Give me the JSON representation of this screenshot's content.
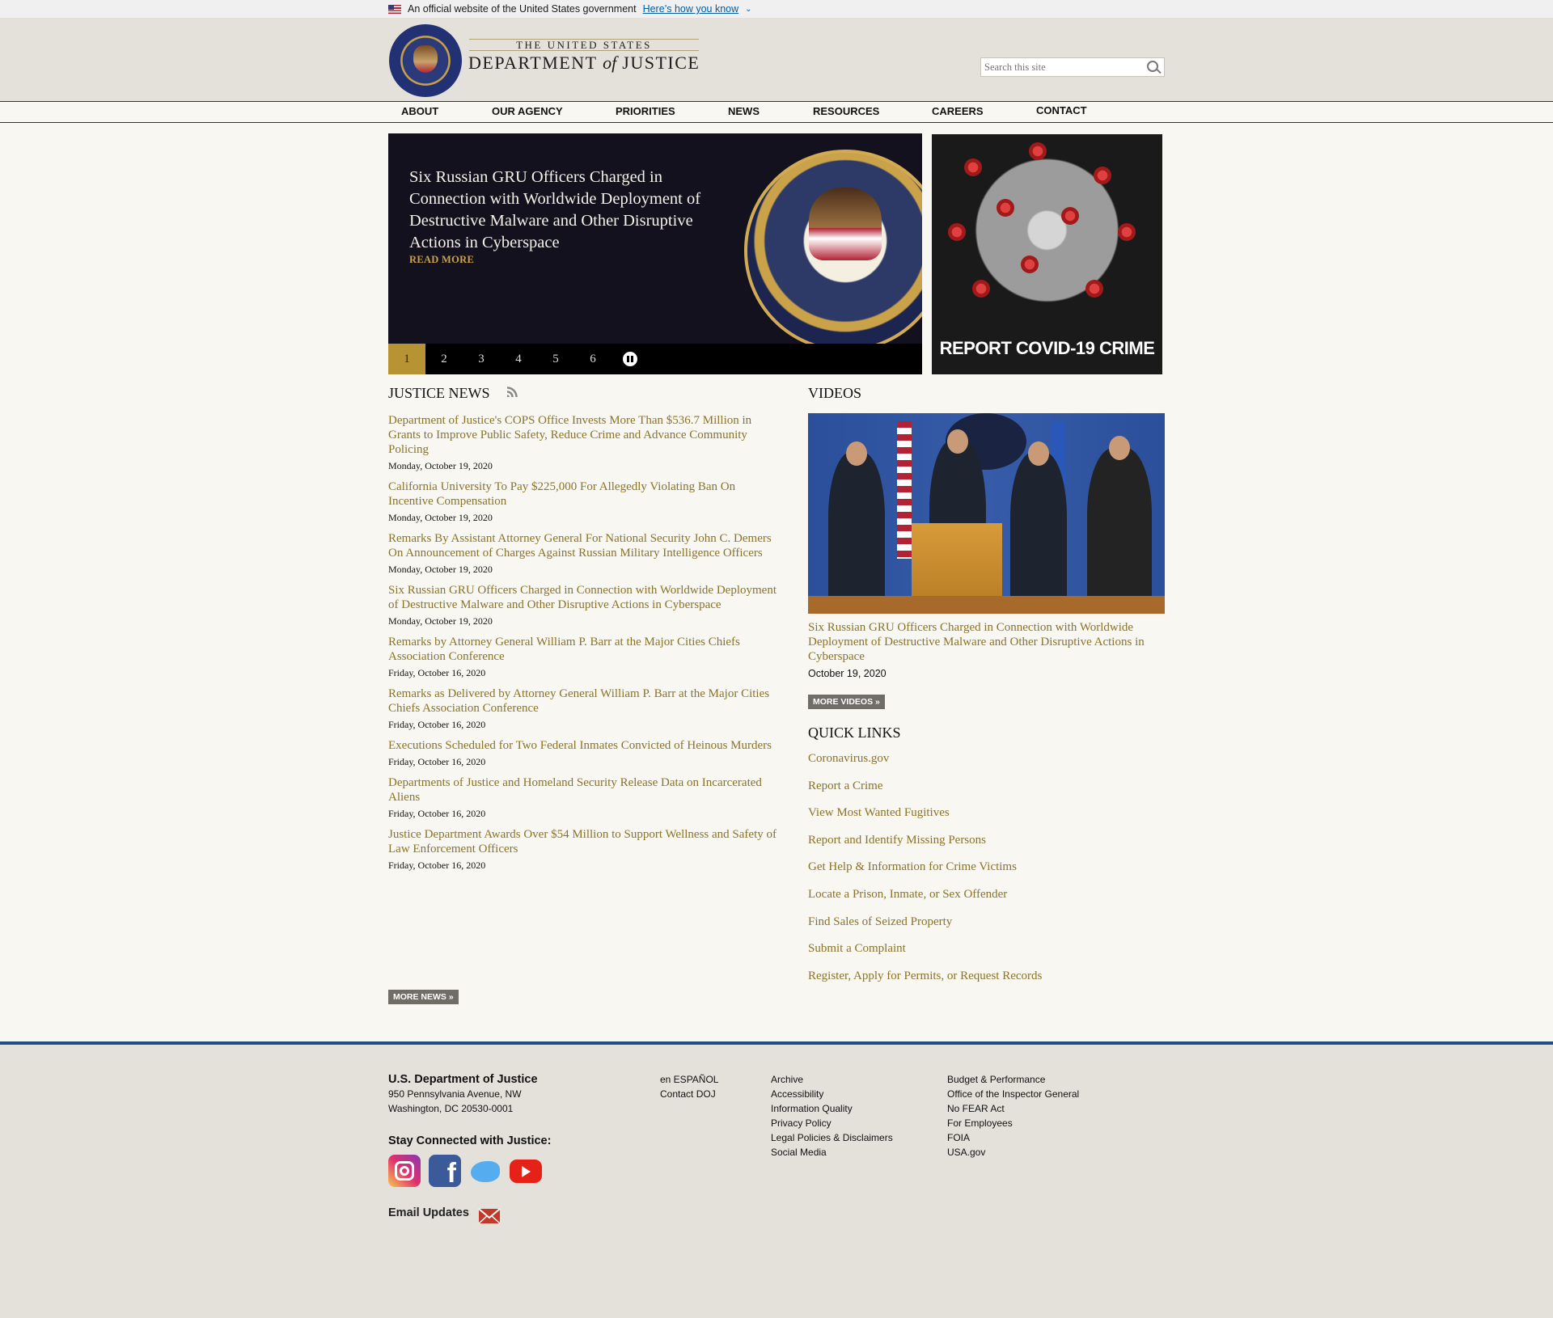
{
  "gov_banner": {
    "text": "An official website of the United States government",
    "link": "Here’s how you know"
  },
  "header": {
    "logo_top": "THE UNITED STATES",
    "logo_main_a": "DEPARTMENT",
    "logo_of": "of",
    "logo_main_b": "JUSTICE",
    "search_placeholder": "Search this site"
  },
  "nav": [
    "About",
    "Our Agency",
    "Priorities",
    "News",
    "Resources",
    "Careers",
    "Contact"
  ],
  "hero": {
    "title": "Six Russian GRU Officers Charged in Connection with Worldwide Deployment of Destructive Malware and Other Disruptive Actions in Cyberspace",
    "read_more": "READ MORE",
    "pages": [
      "1",
      "2",
      "3",
      "4",
      "5",
      "6"
    ]
  },
  "covid_banner": {
    "text": "REPORT COVID-19 CRIME"
  },
  "justice_news": {
    "heading": "JUSTICE NEWS",
    "items": [
      {
        "title": "Department of Justice's COPS Office Invests More Than $536.7 Million in Grants to Improve Public Safety, Reduce Crime and Advance Community Policing",
        "date": "Monday, October 19, 2020"
      },
      {
        "title": "California University To Pay $225,000 For Allegedly Violating Ban On Incentive Compensation",
        "date": "Monday, October 19, 2020"
      },
      {
        "title": "Remarks By Assistant Attorney General For National Security John C. Demers On Announcement of Charges Against Russian Military Intelligence Officers",
        "date": "Monday, October 19, 2020"
      },
      {
        "title": "Six Russian GRU Officers Charged in Connection with Worldwide Deployment of Destructive Malware and Other Disruptive Actions in Cyberspace",
        "date": "Monday, October 19, 2020"
      },
      {
        "title": "Remarks by Attorney General William P. Barr at the Major Cities Chiefs Association Conference",
        "date": "Friday, October 16, 2020"
      },
      {
        "title": "Remarks as Delivered by Attorney General William P. Barr at the Major Cities Chiefs Association Conference",
        "date": "Friday, October 16, 2020"
      },
      {
        "title": "Executions Scheduled for Two Federal Inmates Convicted of Heinous Murders",
        "date": "Friday, October 16, 2020"
      },
      {
        "title": "Departments of Justice and Homeland Security Release Data on Incarcerated Aliens",
        "date": "Friday, October 16, 2020"
      },
      {
        "title": "Justice Department Awards Over $54 Million to Support Wellness and Safety of Law Enforcement Officers",
        "date": "Friday, October 16, 2020"
      }
    ],
    "more": "MORE NEWS »"
  },
  "videos": {
    "heading": "VIDEOS",
    "caption": "Six Russian GRU Officers Charged in Connection with Worldwide Deployment of Destructive Malware and Other Disruptive Actions in Cyberspace",
    "date": "October 19, 2020",
    "more": "MORE VIDEOS »"
  },
  "quick_links": {
    "heading": "QUICK LINKS",
    "items": [
      "Coronavirus.gov",
      "Report a Crime",
      "View Most Wanted Fugitives",
      "Report and Identify Missing Persons",
      "Get Help & Information for Crime Victims",
      "Locate a Prison, Inmate, or Sex Offender",
      "Find Sales of Seized Property",
      "Submit a Complaint",
      "Register, Apply for Permits, or Request Records"
    ]
  },
  "footer": {
    "org": "U.S. Department of Justice",
    "addr1": "950 Pennsylvania Avenue, NW",
    "addr2": "Washington, DC 20530-0001",
    "stay": "Stay Connected with Justice:",
    "email": "Email Updates",
    "col1": [
      "en ESPAÑOL",
      "Contact DOJ"
    ],
    "col2": [
      "Archive",
      "Accessibility",
      "Information Quality",
      "Privacy Policy",
      "Legal Policies & Disclaimers",
      "Social Media"
    ],
    "col3": [
      "Budget & Performance",
      "Office of the Inspector General",
      "No FEAR Act",
      "For Employees",
      "FOIA",
      "USA.gov"
    ]
  },
  "colors": {
    "gold_link": "#8b7327",
    "hero_bg": "#14111e",
    "footer_rule": "#1d4f86",
    "accent_gold": "#b79333"
  }
}
